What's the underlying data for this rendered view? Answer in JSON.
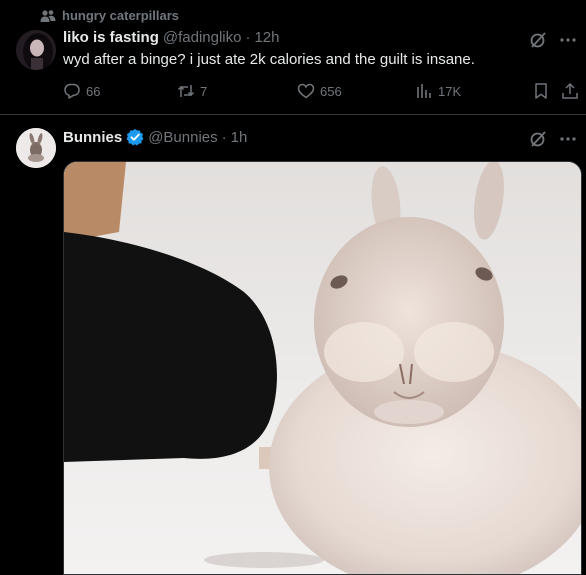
{
  "timeline": {
    "tweets": [
      {
        "social_context": "hungry caterpillars",
        "author": {
          "name": "liko is fasting",
          "handle": "@fadingliko"
        },
        "separator": "·",
        "time": "12h",
        "text": "wyd after a binge? i just ate 2k calories and the guilt is insane.",
        "stats": {
          "replies": "66",
          "retweets": "7",
          "likes": "656",
          "views": "17K"
        }
      },
      {
        "author": {
          "name": "Bunnies",
          "handle": "@Bunnies",
          "verified": true
        },
        "separator": "·",
        "time": "1h",
        "media": {
          "type": "video-thumbnail",
          "subject": "bunny"
        }
      }
    ]
  },
  "colors": {
    "background": "#000000",
    "text_primary": "#e7e9ea",
    "text_secondary": "#71767b",
    "verified_blue": "#1d9bf0",
    "divider": "#2f3336"
  },
  "icons": [
    "people-icon",
    "grok-icon",
    "more-icon",
    "reply-icon",
    "retweet-icon",
    "like-icon",
    "views-icon",
    "bookmark-icon",
    "share-icon",
    "verified-badge-icon"
  ]
}
